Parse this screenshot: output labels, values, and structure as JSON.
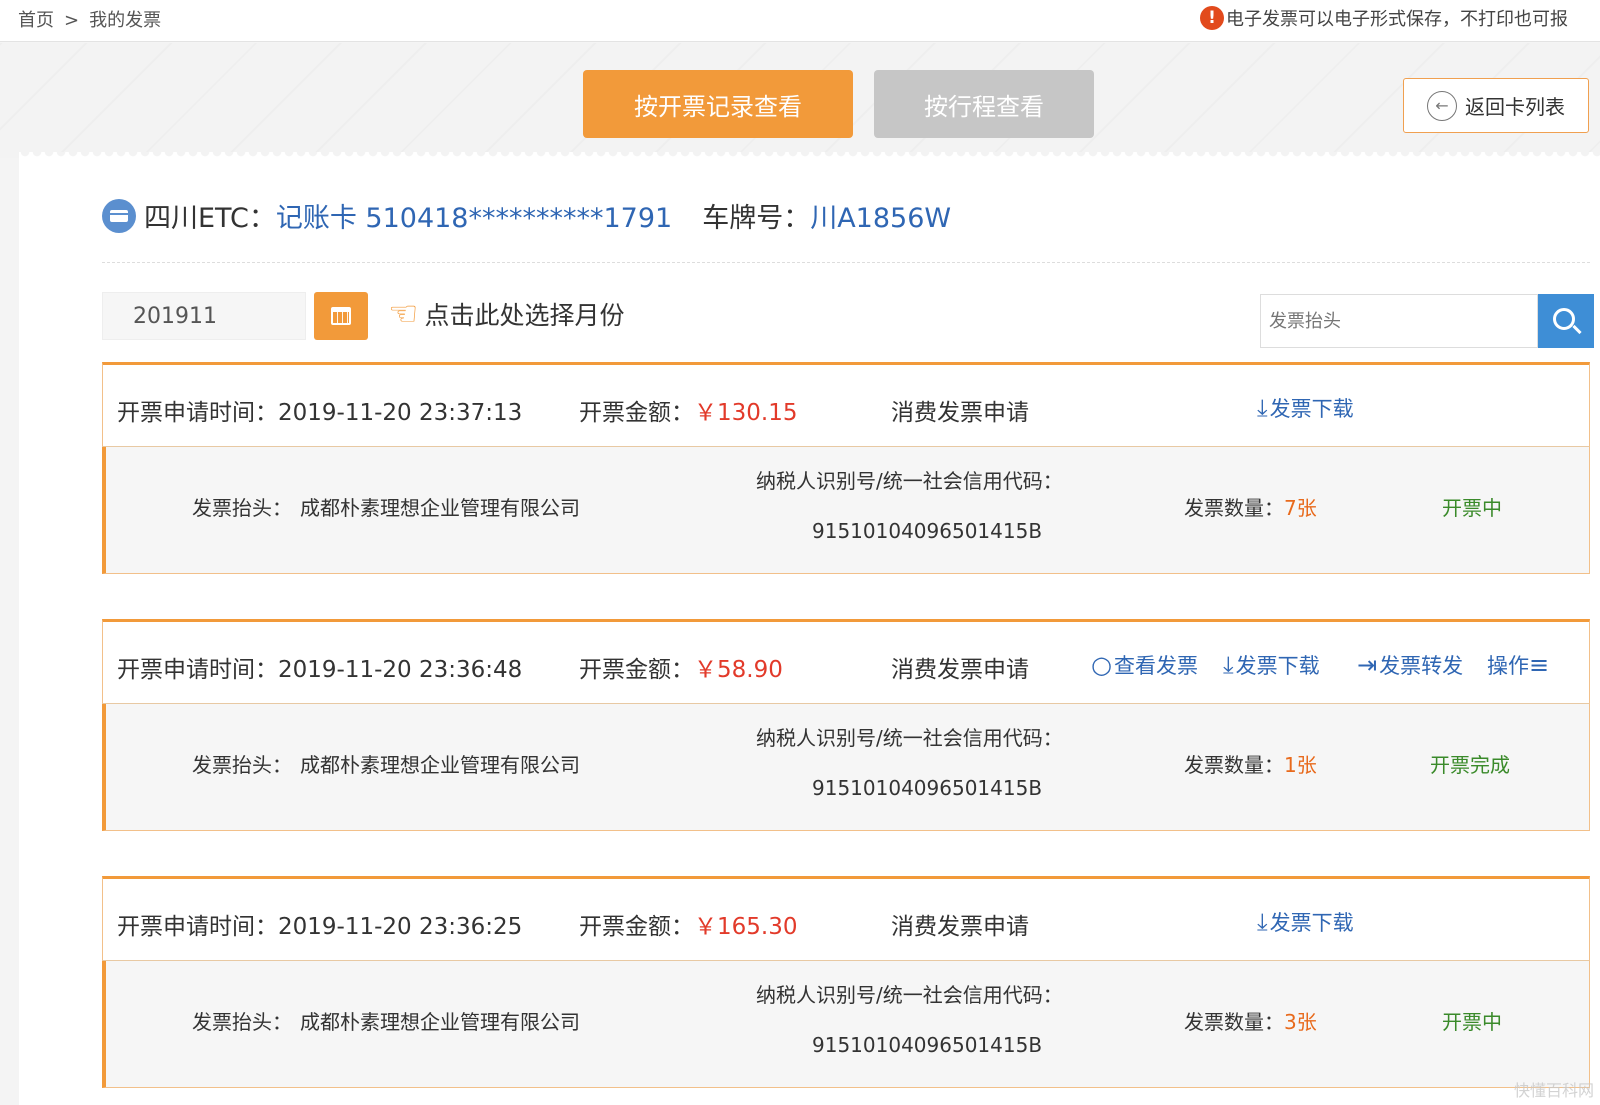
{
  "breadcrumb": {
    "home": "首页",
    "separator": ">",
    "current": "我的发票"
  },
  "notice": "电子发票可以电子形式保存，不打印也可报",
  "tabs": {
    "active": "按开票记录查看",
    "inactive": "按行程查看"
  },
  "back_button": "返回卡列表",
  "card_info": {
    "province_label": "四川ETC：",
    "card_value": "记账卡 510418**********1791",
    "plate_label": "车牌号：",
    "plate_value": "川A1856W"
  },
  "filter": {
    "month_value": "201911",
    "hint": "点击此处选择月份",
    "search_placeholder": "发票抬头"
  },
  "labels": {
    "time": "开票申请时间：",
    "amount": "开票金额：",
    "title": "发票抬头：",
    "tax_id": "纳税人识别号/统一社会信用代码：",
    "quantity": "发票数量："
  },
  "records": [
    {
      "time": "2019-11-20 23:37:13",
      "amount": "￥130.15",
      "type": "消费发票申请",
      "download": "发票下载",
      "invoice_title": "成都朴素理想企业管理有限公司",
      "tax_code": "91510104096501415B",
      "quantity": "7张",
      "status": "开票中",
      "status_color": "#3a8a2a"
    },
    {
      "time": "2019-11-20 23:36:48",
      "amount": "￥58.90",
      "type": "消费发票申请",
      "view": "查看发票",
      "download": "发票下载",
      "forward": "发票转发",
      "operate": "操作",
      "invoice_title": "成都朴素理想企业管理有限公司",
      "tax_code": "91510104096501415B",
      "quantity": "1张",
      "status": "开票完成",
      "status_color": "#3a8a2a"
    },
    {
      "time": "2019-11-20 23:36:25",
      "amount": "￥165.30",
      "type": "消费发票申请",
      "download": "发票下载",
      "invoice_title": "成都朴素理想企业管理有限公司",
      "tax_code": "91510104096501415B",
      "quantity": "3张",
      "status": "开票中",
      "status_color": "#3a8a2a"
    }
  ],
  "watermark": "快懂百科网"
}
